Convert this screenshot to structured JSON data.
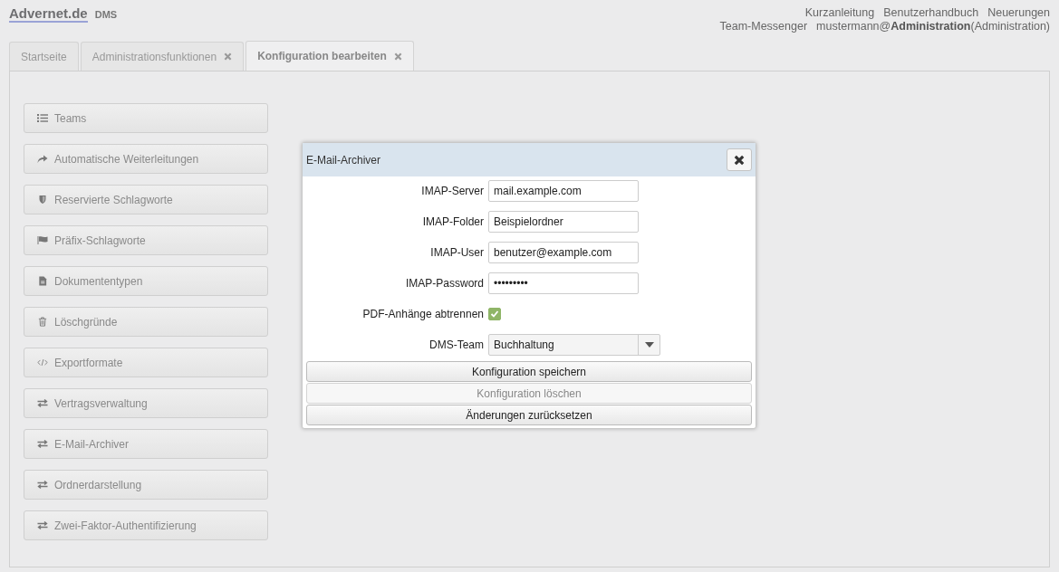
{
  "header": {
    "logo": "Advernet.de",
    "product": "DMS",
    "links": [
      "Kurzanleitung",
      "Benutzerhandbuch",
      "Neuerungen"
    ],
    "messenger": "Team-Messenger",
    "user": "mustermann@**Administration**(Administration)"
  },
  "tabs": [
    {
      "label": "Startseite",
      "selected": false,
      "closable": false
    },
    {
      "label": "Administrationsfunktionen",
      "selected": false,
      "closable": true
    },
    {
      "label": "Konfiguration bearbeiten",
      "selected": true,
      "closable": true
    }
  ],
  "sidebar": {
    "items": [
      {
        "label": "Teams",
        "kind": "list"
      },
      {
        "label": "Automatische Weiterleitungen",
        "kind": "share"
      },
      {
        "label": "Reservierte Schlagworte",
        "kind": "shield"
      },
      {
        "label": "Präfix-Schlagworte",
        "kind": "flag"
      },
      {
        "label": "Dokumententypen",
        "kind": "file"
      },
      {
        "label": "Löschgründe",
        "kind": "trash"
      },
      {
        "label": "Exportformate",
        "kind": "code"
      },
      {
        "label": "Vertragsverwaltung",
        "kind": "exchange"
      },
      {
        "label": "E-Mail-Archiver",
        "kind": "exchange"
      },
      {
        "label": "Ordnerdarstellung",
        "kind": "exchange"
      },
      {
        "label": "Zwei-Faktor-Authentifizierung",
        "kind": "exchange"
      }
    ]
  },
  "dialog": {
    "title": "E-Mail-Archiver",
    "fields": [
      {
        "label": "IMAP-Server",
        "kind": "text",
        "value": "mail.example.com"
      },
      {
        "label": "IMAP-Folder",
        "kind": "text",
        "value": "Beispielordner"
      },
      {
        "label": "IMAP-User",
        "kind": "text",
        "value": "benutzer@example.com"
      },
      {
        "label": "IMAP-Password",
        "kind": "text",
        "value": "•••••••••"
      },
      {
        "label": "PDF-Anhänge abtrennen",
        "kind": "checkbox",
        "checked": true
      },
      {
        "label": "DMS-Team",
        "kind": "select",
        "value": "Buchhaltung"
      }
    ],
    "buttons": [
      {
        "label": "Konfiguration speichern",
        "disabled": false
      },
      {
        "label": "Konfiguration löschen",
        "disabled": true
      },
      {
        "label": "Änderungen zurücksetzen",
        "disabled": false
      }
    ]
  }
}
